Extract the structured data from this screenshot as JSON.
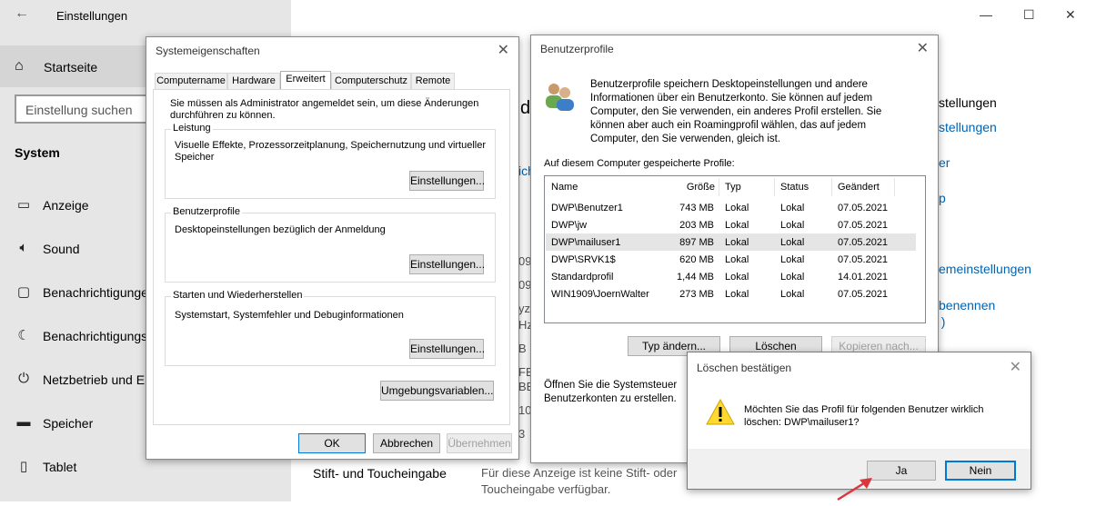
{
  "settings": {
    "title": "Einstellungen",
    "home": "Startseite",
    "search_placeholder": "Einstellung suchen",
    "section": "System",
    "nav": [
      {
        "label": "Anzeige",
        "icon": "monitor-icon"
      },
      {
        "label": "Sound",
        "icon": "speaker-icon"
      },
      {
        "label": "Benachrichtigungen",
        "icon": "notification-icon"
      },
      {
        "label": "Benachrichtigungsassistent",
        "icon": "moon-icon"
      },
      {
        "label": "Netzbetrieb und Energiesparen",
        "icon": "power-icon"
      },
      {
        "label": "Speicher",
        "icon": "storage-icon"
      },
      {
        "label": "Tablet",
        "icon": "tablet-icon"
      }
    ],
    "right_fragments": {
      "heading_letter": "d",
      "link_fragment": "ich",
      "text1": "stellungen",
      "link1": "stellungen",
      "link2": "er",
      "link3": "p",
      "link4": "emeinstellungen",
      "link5": "benennen",
      "link6": " )",
      "pen_heading": "Stift- und Toucheingabe",
      "pen_text1": "Für diese Anzeige ist keine Stift- oder",
      "pen_text2": "Toucheingabe verfügbar.",
      "frag_a": "09",
      "frag_b": "09",
      "frag_c": "yz",
      "frag_d": "Hz",
      "frag_e": "B",
      "frag_f": "FB",
      "frag_g": "BE",
      "frag_h": "10",
      "frag_i": "3"
    }
  },
  "sysprops": {
    "title": "Systemeigenschaften",
    "tabs": [
      "Computername",
      "Hardware",
      "Erweitert",
      "Computerschutz",
      "Remote"
    ],
    "admin_note": "Sie müssen als Administrator angemeldet sein, um diese Änderungen durchführen zu können.",
    "groups": {
      "perf_label": "Leistung",
      "perf_text": "Visuelle Effekte, Prozessorzeitplanung, Speichernutzung und virtueller Speicher",
      "profiles_label": "Benutzerprofile",
      "profiles_text": "Desktopeinstellungen bezüglich der Anmeldung",
      "startup_label": "Starten und Wiederherstellen",
      "startup_text": "Systemstart, Systemfehler und Debuginformationen"
    },
    "settings_button": "Einstellungen...",
    "env_button": "Umgebungsvariablen...",
    "ok": "OK",
    "cancel": "Abbrechen",
    "apply": "Übernehmen"
  },
  "profiles": {
    "title": "Benutzerprofile",
    "intro": "Benutzerprofile speichern Desktopeinstellungen und andere Informationen über ein Benutzerkonto. Sie können auf jedem Computer, den Sie verwenden, ein anderes Profil erstellen. Sie können aber auch ein Roamingprofil wählen, das auf jedem Computer, den Sie verwenden, gleich ist.",
    "list_label": "Auf diesem Computer gespeicherte Profile:",
    "columns": [
      "Name",
      "Größe",
      "Typ",
      "Status",
      "Geändert"
    ],
    "rows": [
      [
        "DWP\\Benutzer1",
        "743 MB",
        "Lokal",
        "Lokal",
        "07.05.2021"
      ],
      [
        "DWP\\jw",
        "203 MB",
        "Lokal",
        "Lokal",
        "07.05.2021"
      ],
      [
        "DWP\\mailuser1",
        "897 MB",
        "Lokal",
        "Lokal",
        "07.05.2021"
      ],
      [
        "DWP\\SRVK1$",
        "620 MB",
        "Lokal",
        "Lokal",
        "07.05.2021"
      ],
      [
        "Standardprofil",
        "1,44 MB",
        "Lokal",
        "Lokal",
        "14.01.2021"
      ],
      [
        "WIN1909\\JoernWalter",
        "273 MB",
        "Lokal",
        "Lokal",
        "07.05.2021"
      ]
    ],
    "change_type": "Typ ändern...",
    "delete": "Löschen",
    "copy": "Kopieren nach...",
    "footer1": "Öffnen Sie die Systemsteuer",
    "footer2": "Benutzerkonten zu erstellen."
  },
  "confirm": {
    "title": "Löschen bestätigen",
    "message1": "Möchten Sie das Profil für folgenden Benutzer wirklich",
    "message2": "löschen: DWP\\mailuser1?",
    "yes": "Ja",
    "no": "Nein"
  },
  "colors": {
    "accent": "#0078d7",
    "link": "#0063b1",
    "arrow": "#d9363e"
  }
}
